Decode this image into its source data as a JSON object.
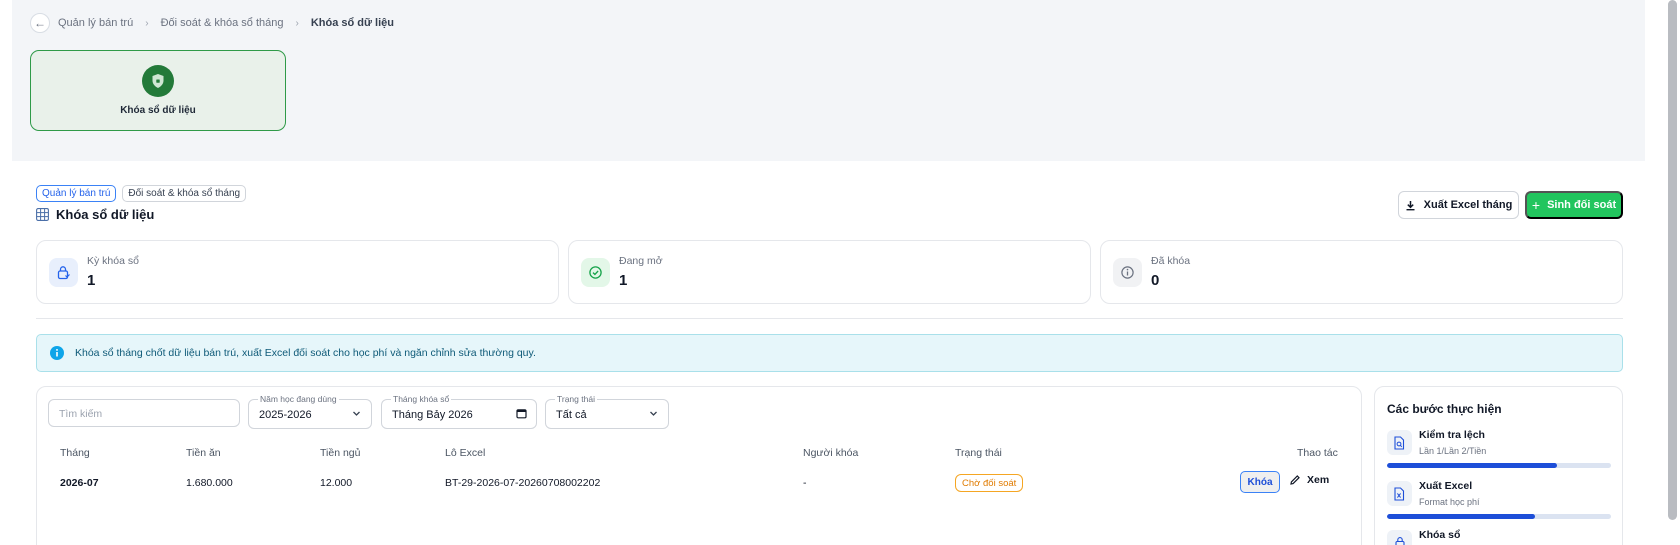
{
  "breadcrumb": {
    "items": [
      "Quản lý bán trú",
      "Đối soát & khóa sổ tháng",
      "Khóa sổ dữ liệu"
    ]
  },
  "module_card": {
    "label": "Khóa sổ dữ liệu"
  },
  "tags": [
    "Quản lý bán trú",
    "Đối soát & khóa sổ tháng"
  ],
  "page_title": "Khóa sổ dữ liệu",
  "actions": {
    "export_label": "Xuất Excel tháng",
    "generate_label": "Sinh đối soát"
  },
  "stats": [
    {
      "label": "Kỳ khóa sổ",
      "value": "1",
      "icon": "calendar-lock-icon",
      "color": "#e8effc"
    },
    {
      "label": "Đang mở",
      "value": "1",
      "icon": "check-circle-icon",
      "color": "#e3f7e8"
    },
    {
      "label": "Đã khóa",
      "value": "0",
      "icon": "info-icon",
      "color": "#f1f2f4"
    }
  ],
  "info_banner": "Khóa sổ tháng chốt dữ liệu bán trú, xuất Excel đối soát cho học phí và ngăn chỉnh sửa thường quy.",
  "filters": {
    "search_placeholder": "Tìm kiếm",
    "school_year": {
      "label": "Năm học đang dùng",
      "value": "2025-2026"
    },
    "month": {
      "label": "Tháng khóa sổ",
      "value": "Tháng Bảy 2026"
    },
    "status": {
      "label": "Trạng thái",
      "value": "Tất cả"
    }
  },
  "table": {
    "headers": [
      "Tháng",
      "Tiền ăn",
      "Tiền ngủ",
      "Lô Excel",
      "Người khóa",
      "Trạng thái",
      "Thao tác"
    ],
    "rows": [
      {
        "month": "2026-07",
        "meal_fee": "1.680.000",
        "sleep_fee": "12.000",
        "excel_batch": "BT-29-2026-07-20260708002202",
        "locked_by": "-",
        "status": "Chờ đối soát",
        "lock_label": "Khóa",
        "view_label": "Xem"
      }
    ]
  },
  "steps": {
    "title": "Các bước thực hiện",
    "items": [
      {
        "name": "Kiểm tra lệch",
        "sub": "Lần 1/Lần 2/Tiền",
        "progress": 0.76,
        "icon": "file-search-icon"
      },
      {
        "name": "Xuất Excel",
        "sub": "Format học phí",
        "progress": 0.66,
        "icon": "file-excel-icon"
      },
      {
        "name": "Khóa sổ",
        "sub": "",
        "progress": 0,
        "icon": "lock-icon"
      }
    ]
  }
}
